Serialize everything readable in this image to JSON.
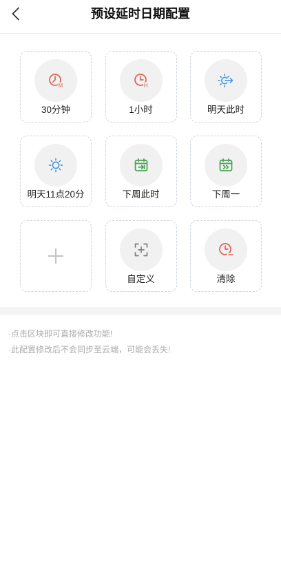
{
  "header": {
    "title": "预设延时日期配置",
    "back_icon": "chevron-left-icon"
  },
  "presets": [
    {
      "label": "30分钟",
      "icon": "clock-minutes-icon",
      "badge": "M",
      "color": "#db6052"
    },
    {
      "label": "1小时",
      "icon": "clock-hour-icon",
      "badge": "H",
      "color": "#db6052"
    },
    {
      "label": "明天此时",
      "icon": "sun-arrow-icon",
      "color": "#4c9ce4"
    },
    {
      "label": "明天11点20分",
      "icon": "sun-icon",
      "color": "#4c9ce4"
    },
    {
      "label": "下周此时",
      "icon": "calendar-arrow-icon",
      "color": "#47a454"
    },
    {
      "label": "下周一",
      "icon": "calendar-next-icon",
      "color": "#47a454"
    },
    {
      "label": "自定义",
      "icon": "scan-plus-icon",
      "color": "#7f7f7f"
    },
    {
      "label": "清除",
      "icon": "clock-clear-icon",
      "color": "#db6052"
    }
  ],
  "add_tile": {
    "icon": "plus-icon",
    "color": "#c2c2c2"
  },
  "notes": [
    "·点击区块即可直接修改功能!",
    "·此配置修改后不会同步至云端，可能会丢失!"
  ],
  "theme": {
    "tile_border": "#cdd4de",
    "icon_bg": "#f1f1f1",
    "separator": "#f4f4f4",
    "note_text": "#ababab",
    "label_text": "#222222",
    "title_text": "#111111"
  }
}
